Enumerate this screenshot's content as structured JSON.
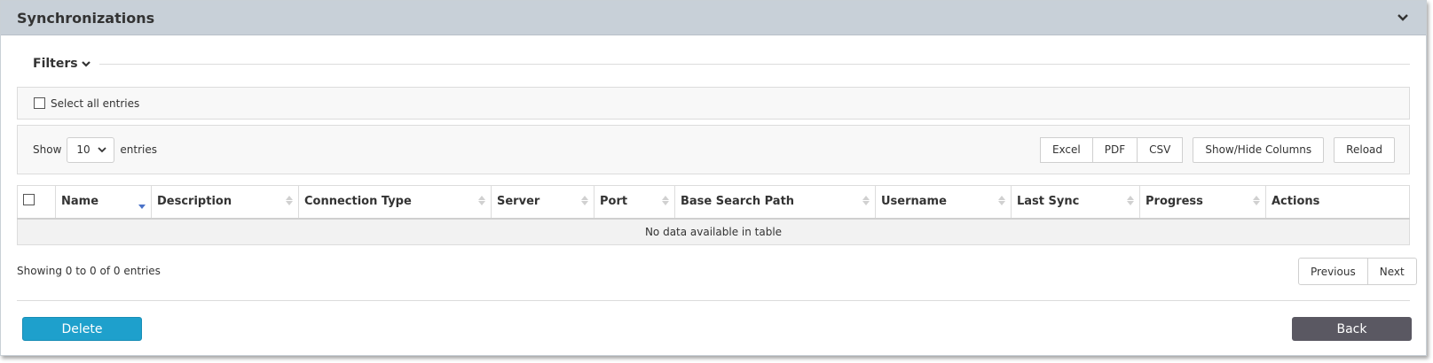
{
  "panel": {
    "title": "Synchronizations",
    "collapse_icon": "chevron-down-icon"
  },
  "filters": {
    "label": "Filters",
    "icon": "chevron-down-icon"
  },
  "select_all": {
    "label": "Select all entries",
    "checked": false
  },
  "length_menu": {
    "show_label": "Show",
    "selected": "10",
    "entries_label": "entries"
  },
  "toolbar": {
    "excel": "Excel",
    "pdf": "PDF",
    "csv": "CSV",
    "show_hide_columns": "Show/Hide Columns",
    "reload": "Reload"
  },
  "table": {
    "columns": [
      "Name",
      "Description",
      "Connection Type",
      "Server",
      "Port",
      "Base Search Path",
      "Username",
      "Last Sync",
      "Progress",
      "Actions"
    ],
    "sorted_column": "Name",
    "sort_direction": "descending",
    "empty_message": "No data available in table"
  },
  "info": "Showing 0 to 0 of 0 entries",
  "pagination": {
    "previous": "Previous",
    "next": "Next"
  },
  "actions": {
    "delete": "Delete",
    "back": "Back"
  },
  "colors": {
    "header_bg": "#c8d0d8",
    "delete_bg": "#1ea0cc",
    "back_bg": "#5a5862",
    "sort_active": "#4a72c8"
  }
}
